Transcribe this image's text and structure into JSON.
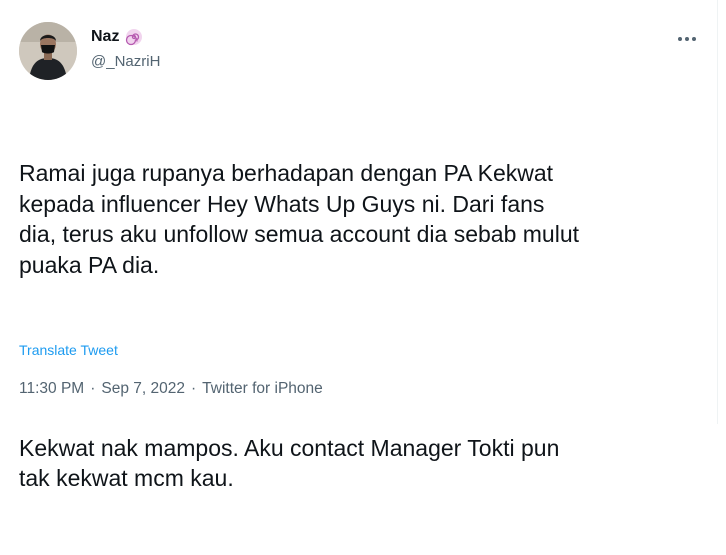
{
  "user": {
    "display_name": "Naz",
    "handle": "@_NazriH",
    "badge_icon": "spiral-emoji-icon",
    "avatar_icon": "profile-photo-avatar"
  },
  "tweet": {
    "paragraphs": [
      "Ramai juga rupanya berhadapan dengan PA Kekwat\nkepada influencer Hey Whats Up Guys ni. Dari fans\ndia, terus aku unfollow semua account dia sebab mulut\npuaka PA dia.",
      "Kekwat nak mampos. Aku contact Manager Tokti pun\ntak kekwat mcm kau."
    ],
    "translate_label": "Translate Tweet"
  },
  "meta": {
    "time": "11:30 PM",
    "separator": "·",
    "date": "Sep 7, 2022",
    "source": "Twitter for iPhone"
  },
  "more_icon": "more-horizontal-icon",
  "colors": {
    "text": "#0f1419",
    "secondary": "#536471",
    "link": "#1d9bf0"
  }
}
